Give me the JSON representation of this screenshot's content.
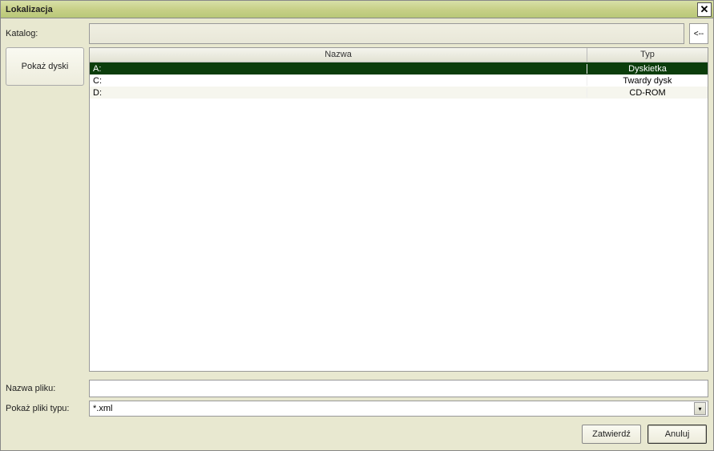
{
  "window": {
    "title": "Lokalizacja"
  },
  "labels": {
    "katalog": "Katalog:",
    "nazwa_pliku": "Nazwa pliku:",
    "pokaz_pliki_typu": "Pokaż pliki typu:",
    "back_btn": "<--"
  },
  "buttons": {
    "pokaz_dyski": "Pokaż dyski",
    "zatwierdz": "Zatwierdź",
    "anuluj": "Anuluj"
  },
  "katalog_value": "",
  "table": {
    "headers": {
      "name": "Nazwa",
      "type": "Typ"
    },
    "rows": [
      {
        "name": "A:",
        "type": "Dyskietka",
        "selected": true
      },
      {
        "name": "C:",
        "type": "Twardy dysk",
        "selected": false
      },
      {
        "name": "D:",
        "type": "CD-ROM",
        "selected": false
      }
    ]
  },
  "filename_value": "",
  "filetype_value": "*.xml"
}
